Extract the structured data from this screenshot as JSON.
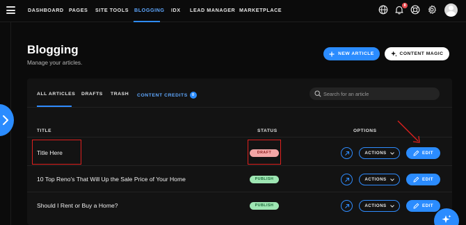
{
  "nav": {
    "items": [
      {
        "label": "DASHBOARD"
      },
      {
        "label": "PAGES"
      },
      {
        "label": "SITE TOOLS"
      },
      {
        "label": "BLOGGING"
      },
      {
        "label": "IDX"
      },
      {
        "label": "LEAD MANAGER"
      },
      {
        "label": "MARKETPLACE"
      }
    ],
    "active": "BLOGGING",
    "notification_count": "8",
    "icons": [
      "menu-icon",
      "globe-icon",
      "bell-icon",
      "help-icon",
      "gear-icon",
      "avatar"
    ]
  },
  "header": {
    "title": "Blogging",
    "subtitle": "Manage your articles.",
    "new_article": "NEW ARTICLE",
    "content_magic": "CONTENT MAGIC"
  },
  "tabs": {
    "all": "ALL ARTICLES",
    "drafts": "DRAFTS",
    "trash": "TRASH",
    "credits": "CONTENT CREDITS",
    "credits_count": "0",
    "active": "ALL ARTICLES"
  },
  "search": {
    "placeholder": "Search for an article"
  },
  "table": {
    "headers": {
      "title": "TITLE",
      "status": "STATUS",
      "options": "OPTIONS"
    },
    "actions_label": "ACTIONS",
    "edit_label": "EDIT",
    "rows": [
      {
        "title": "Title Here",
        "status": "DRAFT"
      },
      {
        "title": "10 Top Reno's That Will Up the Sale Price of Your Home",
        "status": "PUBLISH"
      },
      {
        "title": "Should I Rent or Buy a Home?",
        "status": "PUBLISH"
      }
    ]
  },
  "colors": {
    "accent": "#2b8cff",
    "background": "#0b0b0b",
    "panel": "#131313",
    "draft_badge": "#f3a6a6",
    "publish_badge": "#9ee6b3",
    "annotation": "#e0201e"
  }
}
